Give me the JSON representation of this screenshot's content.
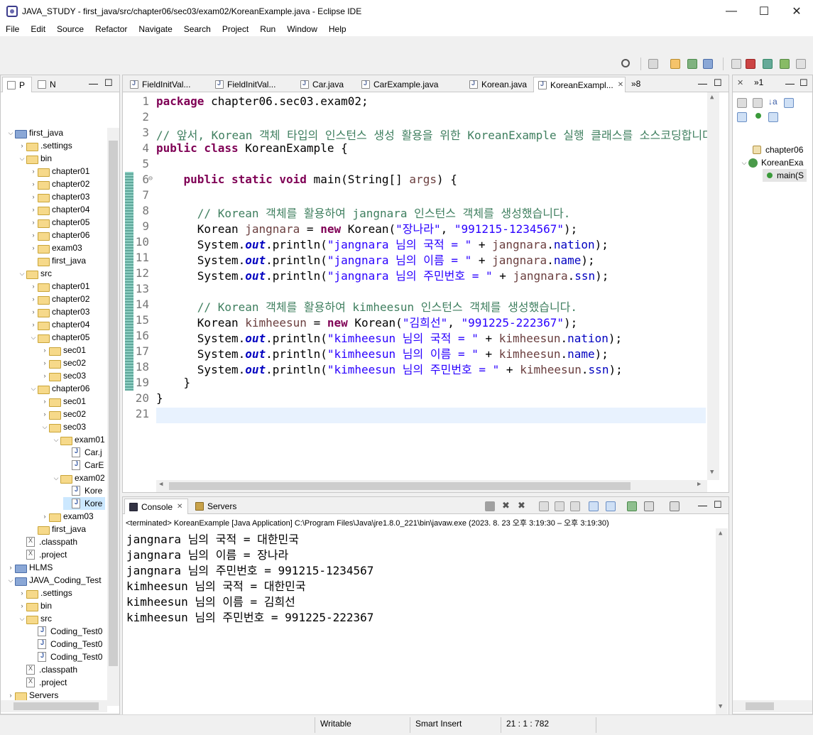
{
  "window": {
    "title": "JAVA_STUDY - first_java/src/chapter06/sec03/exam02/KoreanExample.java - Eclipse IDE",
    "minimize": "—",
    "maximize": "☐",
    "close": "✕"
  },
  "menu": [
    "File",
    "Edit",
    "Source",
    "Refactor",
    "Navigate",
    "Search",
    "Project",
    "Run",
    "Window",
    "Help"
  ],
  "left_panel": {
    "tabs": [
      "P",
      "N"
    ],
    "tree": [
      {
        "label": "first_java",
        "kind": "project",
        "open": true
      },
      {
        "label": ".settings",
        "kind": "folder",
        "open": false
      },
      {
        "label": "bin",
        "kind": "folder",
        "open": true
      },
      {
        "label": "chapter01",
        "kind": "folder",
        "open": false
      },
      {
        "label": "chapter02",
        "kind": "folder",
        "open": false
      },
      {
        "label": "chapter03",
        "kind": "folder",
        "open": false
      },
      {
        "label": "chapter04",
        "kind": "folder",
        "open": false
      },
      {
        "label": "chapter05",
        "kind": "folder",
        "open": false
      },
      {
        "label": "chapter06",
        "kind": "folder",
        "open": false
      },
      {
        "label": "exam03",
        "kind": "folder",
        "open": false
      },
      {
        "label": "first_java",
        "kind": "folder",
        "open": null
      },
      {
        "label": "src",
        "kind": "folder",
        "open": true
      },
      {
        "label": "chapter01",
        "kind": "folder",
        "open": false
      },
      {
        "label": "chapter02",
        "kind": "folder",
        "open": false
      },
      {
        "label": "chapter03",
        "kind": "folder",
        "open": false
      },
      {
        "label": "chapter04",
        "kind": "folder",
        "open": false
      },
      {
        "label": "chapter05",
        "kind": "folder",
        "open": true
      },
      {
        "label": "sec01",
        "kind": "folder",
        "open": false
      },
      {
        "label": "sec02",
        "kind": "folder",
        "open": false
      },
      {
        "label": "sec03",
        "kind": "folder",
        "open": false
      },
      {
        "label": "chapter06",
        "kind": "folder",
        "open": true
      },
      {
        "label": "sec01",
        "kind": "folder",
        "open": false
      },
      {
        "label": "sec02",
        "kind": "folder",
        "open": false
      },
      {
        "label": "sec03",
        "kind": "folder",
        "open": true
      },
      {
        "label": "exam01",
        "kind": "folder",
        "open": true
      },
      {
        "label": "Car.j",
        "kind": "java",
        "open": null
      },
      {
        "label": "CarE",
        "kind": "java",
        "open": null
      },
      {
        "label": "exam02",
        "kind": "folder",
        "open": true
      },
      {
        "label": "Kore",
        "kind": "java",
        "open": null
      },
      {
        "label": "Kore",
        "kind": "java",
        "open": null,
        "selected": true
      },
      {
        "label": "exam03",
        "kind": "folder",
        "open": false
      },
      {
        "label": "first_java",
        "kind": "folder",
        "open": null
      },
      {
        "label": ".classpath",
        "kind": "xml",
        "open": null
      },
      {
        "label": ".project",
        "kind": "xml",
        "open": null
      },
      {
        "label": "HLMS",
        "kind": "project",
        "open": false
      },
      {
        "label": "JAVA_Coding_Test",
        "kind": "project",
        "open": true
      },
      {
        "label": ".settings",
        "kind": "folder",
        "open": false
      },
      {
        "label": "bin",
        "kind": "folder",
        "open": false
      },
      {
        "label": "src",
        "kind": "folder",
        "open": true
      },
      {
        "label": "Coding_Test0",
        "kind": "java",
        "open": null
      },
      {
        "label": "Coding_Test0",
        "kind": "java",
        "open": null
      },
      {
        "label": "Coding_Test0",
        "kind": "java",
        "open": null
      },
      {
        "label": ".classpath",
        "kind": "xml",
        "open": null
      },
      {
        "label": ".project",
        "kind": "xml",
        "open": null
      },
      {
        "label": "Servers",
        "kind": "folder",
        "open": false
      }
    ]
  },
  "editor": {
    "tabs": [
      "FieldInitVal...",
      "FieldInitVal...",
      "Car.java",
      "CarExample.java",
      "Korean.java",
      "KoreanExampl..."
    ],
    "overflow": "»8",
    "lines": [
      [
        [
          "kw",
          "package"
        ],
        [
          "",
          " chapter06.sec03.exam02;"
        ]
      ],
      [],
      [
        [
          "cm",
          "// 앞서, Korean 객체 타입의 인스턴스 생성 활용을 위한 KoreanExample 실행 클래스를 소스코딩합니다."
        ]
      ],
      [
        [
          "kw",
          "public class"
        ],
        [
          "",
          " KoreanExample {"
        ]
      ],
      [],
      [
        [
          "",
          "    "
        ],
        [
          "kw",
          "public static void"
        ],
        [
          "",
          " main(String[] "
        ],
        [
          "lv",
          "args"
        ],
        [
          "",
          ") {"
        ]
      ],
      [],
      [
        [
          "",
          "      "
        ],
        [
          "cm",
          "// Korean 객체를 활용하여 jangnara 인스턴스 객체를 생성했습니다."
        ]
      ],
      [
        [
          "",
          "      Korean "
        ],
        [
          "lv",
          "jangnara"
        ],
        [
          "",
          " = "
        ],
        [
          "kw",
          "new"
        ],
        [
          "",
          " Korean("
        ],
        [
          "str",
          "\"장나라\""
        ],
        [
          "",
          ", "
        ],
        [
          "str",
          "\"991215-1234567\""
        ],
        [
          "",
          ");"
        ]
      ],
      [
        [
          "",
          "      System."
        ],
        [
          "sfld",
          "out"
        ],
        [
          "",
          ".println("
        ],
        [
          "str",
          "\"jangnara 님의 국적 = \""
        ],
        [
          "",
          " + "
        ],
        [
          "lv",
          "jangnara"
        ],
        [
          "",
          "."
        ],
        [
          "fld",
          "nation"
        ],
        [
          "",
          ");"
        ]
      ],
      [
        [
          "",
          "      System."
        ],
        [
          "sfld",
          "out"
        ],
        [
          "",
          ".println("
        ],
        [
          "str",
          "\"jangnara 님의 이름 = \""
        ],
        [
          "",
          " + "
        ],
        [
          "lv",
          "jangnara"
        ],
        [
          "",
          "."
        ],
        [
          "fld",
          "name"
        ],
        [
          "",
          ");"
        ]
      ],
      [
        [
          "",
          "      System."
        ],
        [
          "sfld",
          "out"
        ],
        [
          "",
          ".println("
        ],
        [
          "str",
          "\"jangnara 님의 주민번호 = \""
        ],
        [
          "",
          " + "
        ],
        [
          "lv",
          "jangnara"
        ],
        [
          "",
          "."
        ],
        [
          "fld",
          "ssn"
        ],
        [
          "",
          ");"
        ]
      ],
      [],
      [
        [
          "",
          "      "
        ],
        [
          "cm",
          "// Korean 객체를 활용하여 kimheesun 인스턴스 객체를 생성했습니다."
        ]
      ],
      [
        [
          "",
          "      Korean "
        ],
        [
          "lv",
          "kimheesun"
        ],
        [
          "",
          " = "
        ],
        [
          "kw",
          "new"
        ],
        [
          "",
          " Korean("
        ],
        [
          "str",
          "\"김희선\""
        ],
        [
          "",
          ", "
        ],
        [
          "str",
          "\"991225-222367\""
        ],
        [
          "",
          ");"
        ]
      ],
      [
        [
          "",
          "      System."
        ],
        [
          "sfld",
          "out"
        ],
        [
          "",
          ".println("
        ],
        [
          "str",
          "\"kimheesun 님의 국적 = \""
        ],
        [
          "",
          " + "
        ],
        [
          "lv",
          "kimheesun"
        ],
        [
          "",
          "."
        ],
        [
          "fld",
          "nation"
        ],
        [
          "",
          ");"
        ]
      ],
      [
        [
          "",
          "      System."
        ],
        [
          "sfld",
          "out"
        ],
        [
          "",
          ".println("
        ],
        [
          "str",
          "\"kimheesun 님의 이름 = \""
        ],
        [
          "",
          " + "
        ],
        [
          "lv",
          "kimheesun"
        ],
        [
          "",
          "."
        ],
        [
          "fld",
          "name"
        ],
        [
          "",
          ");"
        ]
      ],
      [
        [
          "",
          "      System."
        ],
        [
          "sfld",
          "out"
        ],
        [
          "",
          ".println("
        ],
        [
          "str",
          "\"kimheesun 님의 주민번호 = \""
        ],
        [
          "",
          " + "
        ],
        [
          "lv",
          "kimheesun"
        ],
        [
          "",
          "."
        ],
        [
          "fld",
          "ssn"
        ],
        [
          "",
          ");"
        ]
      ],
      [
        [
          "",
          "    }"
        ]
      ],
      [
        [
          "",
          "}"
        ]
      ],
      []
    ],
    "folding_marker": "⊖"
  },
  "console": {
    "tabs": [
      "Console",
      "Servers"
    ],
    "header": "<terminated> KoreanExample [Java Application] C:\\Program Files\\Java\\jre1.8.0_221\\bin\\javaw.exe  (2023. 8. 23 오후 3:19:30 – 오후 3:19:30)",
    "output": [
      "jangnara 님의 국적 = 대한민국",
      "jangnara 님의 이름 = 장나라",
      "jangnara 님의 주민번호 = 991215-1234567",
      "kimheesun 님의 국적 = 대한민국",
      "kimheesun 님의 이름 = 김희선",
      "kimheesun 님의 주민번호 = 991225-222367"
    ]
  },
  "outline": {
    "tree": [
      "chapter06",
      "KoreanExa",
      "main(S"
    ]
  },
  "status": {
    "writable": "Writable",
    "insert_mode": "Smart Insert",
    "position": "21 : 1 : 782"
  }
}
